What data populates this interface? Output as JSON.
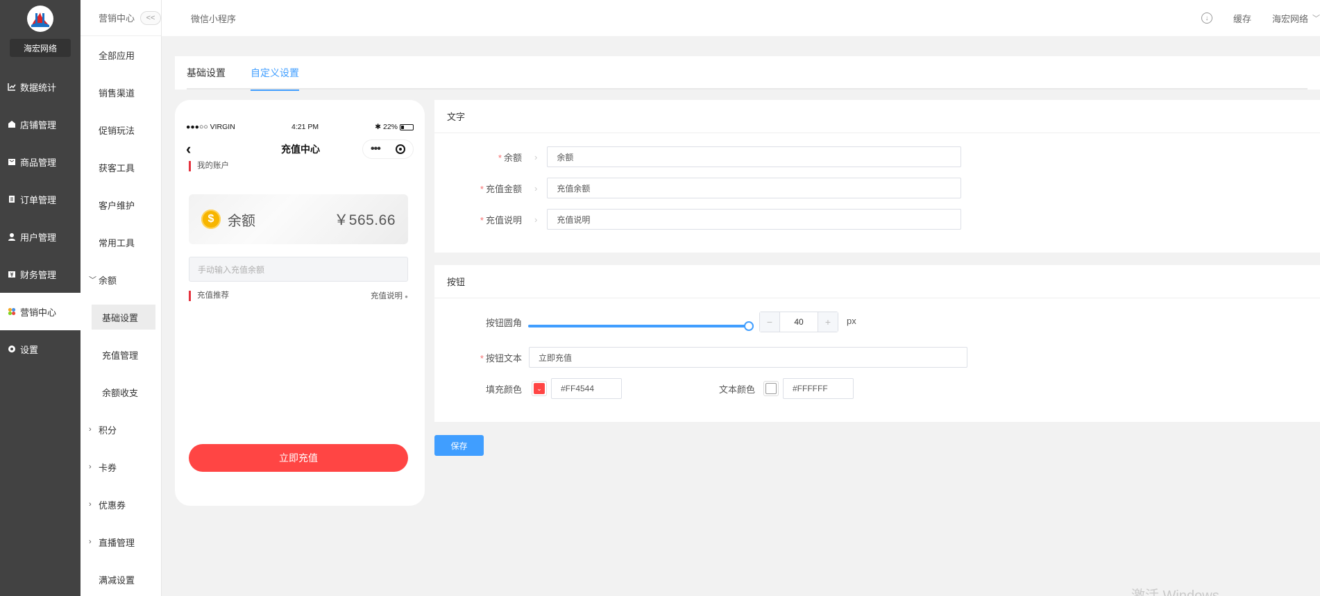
{
  "sidebar": {
    "brand": "海宏网络",
    "items": [
      {
        "label": "数据统计",
        "icon": "line-chart-icon"
      },
      {
        "label": "店铺管理",
        "icon": "store-icon"
      },
      {
        "label": "商品管理",
        "icon": "goods-icon"
      },
      {
        "label": "订单管理",
        "icon": "order-icon"
      },
      {
        "label": "用户管理",
        "icon": "user-icon"
      },
      {
        "label": "财务管理",
        "icon": "finance-icon"
      },
      {
        "label": "营销中心",
        "icon": "marketing-icon"
      },
      {
        "label": "设置",
        "icon": "gear-icon"
      }
    ]
  },
  "subnav": {
    "title": "营销中心",
    "collapse": "<<",
    "items": [
      "全部应用",
      "销售渠道",
      "促销玩法",
      "获客工具",
      "客户维护",
      "常用工具"
    ],
    "balance_group": "余额",
    "balance_children": [
      "基础设置",
      "充值管理",
      "余额收支"
    ],
    "groups": [
      "积分",
      "卡券",
      "优惠券",
      "直播管理"
    ],
    "last": "满减设置"
  },
  "topbar": {
    "crumb": "微信小程序",
    "cache": "缓存",
    "user": "海宏网络"
  },
  "tabs": [
    "基础设置",
    "自定义设置"
  ],
  "phone": {
    "carrier": "●●●○○ VIRGIN",
    "time": "4:21 PM",
    "battery": "22%",
    "title": "充值中心",
    "my_account": "我的账户",
    "balance_label": "余额",
    "balance_value": "￥565.66",
    "input_placeholder": "手动输入充值余额",
    "recommend": "充值推荐",
    "explain": "充值说明",
    "button": "立即充值"
  },
  "text_panel": {
    "title": "文字",
    "fields": [
      {
        "label": "余额",
        "value": "余额"
      },
      {
        "label": "充值金额",
        "value": "充值余额"
      },
      {
        "label": "充值说明",
        "value": "充值说明"
      }
    ]
  },
  "button_panel": {
    "title": "按钮",
    "radius_label": "按钮圆角",
    "radius_value": "40",
    "radius_fraction": 1.0,
    "unit": "px",
    "text_label": "按钮文本",
    "text_value": "立即充值",
    "fill_label": "填充颜色",
    "fill_value": "#FF4544",
    "color_label": "文本颜色",
    "color_value": "#FFFFFF"
  },
  "save": "保存",
  "watermark": "激活 Windows",
  "colors": {
    "accent": "#409eff",
    "button_red": "#ff4544",
    "sidebar_bg": "#424242"
  }
}
